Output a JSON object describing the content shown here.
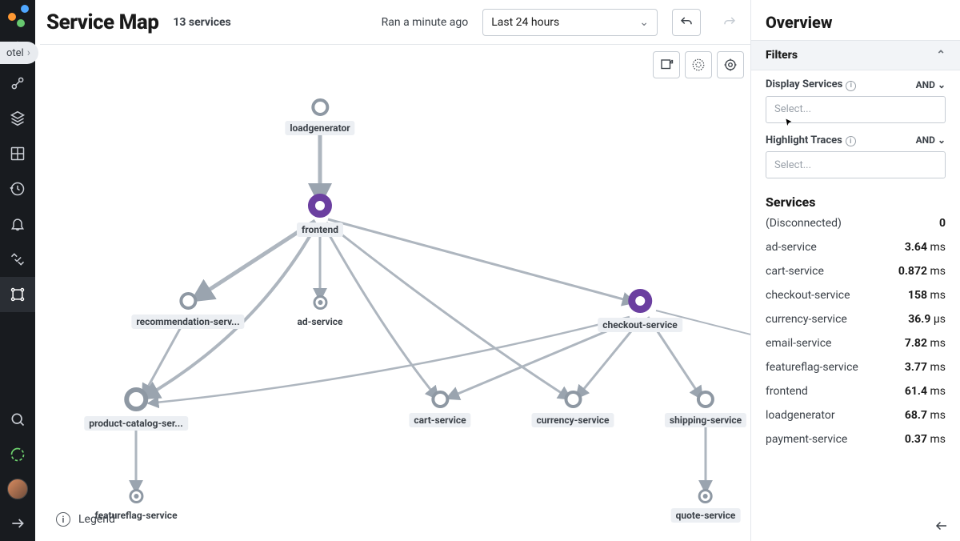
{
  "env_chip": "otel",
  "header": {
    "title": "Service Map",
    "count": "13 services",
    "ran": "Ran a minute ago",
    "timerange": "Last 24 hours"
  },
  "overview": {
    "title": "Overview",
    "filters_title": "Filters",
    "display_services_label": "Display Services",
    "highlight_traces_label": "Highlight Traces",
    "and_label": "AND",
    "select_placeholder": "Select...",
    "services_title": "Services"
  },
  "services": [
    {
      "name": "(Disconnected)",
      "value": "0",
      "unit": ""
    },
    {
      "name": "ad-service",
      "value": "3.64",
      "unit": "ms"
    },
    {
      "name": "cart-service",
      "value": "0.872",
      "unit": "ms"
    },
    {
      "name": "checkout-service",
      "value": "158",
      "unit": "ms"
    },
    {
      "name": "currency-service",
      "value": "36.9",
      "unit": "µs"
    },
    {
      "name": "email-service",
      "value": "7.82",
      "unit": "ms"
    },
    {
      "name": "featureflag-service",
      "value": "3.77",
      "unit": "ms"
    },
    {
      "name": "frontend",
      "value": "61.4",
      "unit": "ms"
    },
    {
      "name": "loadgenerator",
      "value": "68.7",
      "unit": "ms"
    },
    {
      "name": "payment-service",
      "value": "0.37",
      "unit": "ms"
    }
  ],
  "nodes": {
    "loadgenerator": "loadgenerator",
    "frontend": "frontend",
    "recommendation": "recommendation-serv...",
    "ad": "ad-service",
    "checkout": "checkout-service",
    "product": "product-catalog-ser...",
    "cart": "cart-service",
    "currency": "currency-service",
    "shipping": "shipping-service",
    "featureflag": "featureflag-service",
    "quote": "quote-service"
  },
  "legend": "Legend"
}
